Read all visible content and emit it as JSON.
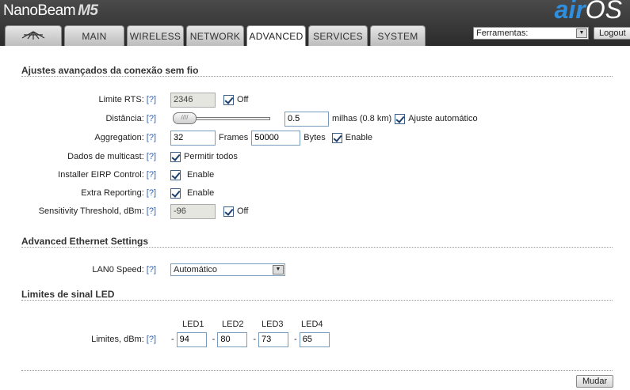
{
  "header": {
    "brand": "NanoBeam",
    "model": "M5",
    "logo_air": "air",
    "logo_os": "OS",
    "tabs": [
      {
        "label": "",
        "icon": "ubiquiti-logo-icon"
      },
      {
        "label": "MAIN"
      },
      {
        "label": "WIRELESS"
      },
      {
        "label": "NETWORK"
      },
      {
        "label": "ADVANCED"
      },
      {
        "label": "SERVICES"
      },
      {
        "label": "SYSTEM"
      }
    ],
    "active_tab": "ADVANCED",
    "tools_select": "Ferramentas:",
    "logout": "Logout"
  },
  "wireless": {
    "title": "Ajustes avançados da conexão sem fio",
    "help": "[?]",
    "rts": {
      "label": "Limite RTS:",
      "value": "2346",
      "checkbox_label": "Off",
      "checked": true
    },
    "distance": {
      "label": "Distância:",
      "value": "0.5",
      "unit": "milhas (0.8 km)",
      "auto_label": "Ajuste automático",
      "checked": true
    },
    "aggregation": {
      "label": "Aggregation:",
      "frames": "32",
      "frames_label": "Frames",
      "bytes": "50000",
      "bytes_label": "Bytes",
      "enable_label": "Enable",
      "checked": true
    },
    "multicast": {
      "label": "Dados de multicast:",
      "checkbox_label": "Permitir todos",
      "checked": true
    },
    "eirp": {
      "label": "Installer EIRP Control:",
      "checkbox_label": "Enable",
      "checked": true
    },
    "extra": {
      "label": "Extra Reporting:",
      "checkbox_label": "Enable",
      "checked": true
    },
    "sensitivity": {
      "label": "Sensitivity Threshold, dBm:",
      "value": "-96",
      "checkbox_label": "Off",
      "checked": true
    }
  },
  "ethernet": {
    "title": "Advanced Ethernet Settings",
    "lan_label": "LAN0 Speed:",
    "lan_value": "Automático"
  },
  "led": {
    "title": "Limites de sinal LED",
    "headers": [
      "LED1",
      "LED2",
      "LED3",
      "LED4"
    ],
    "label": "Limites, dBm:",
    "values": [
      "94",
      "80",
      "73",
      "65"
    ],
    "dash": "-"
  },
  "footer": {
    "change": "Mudar"
  }
}
